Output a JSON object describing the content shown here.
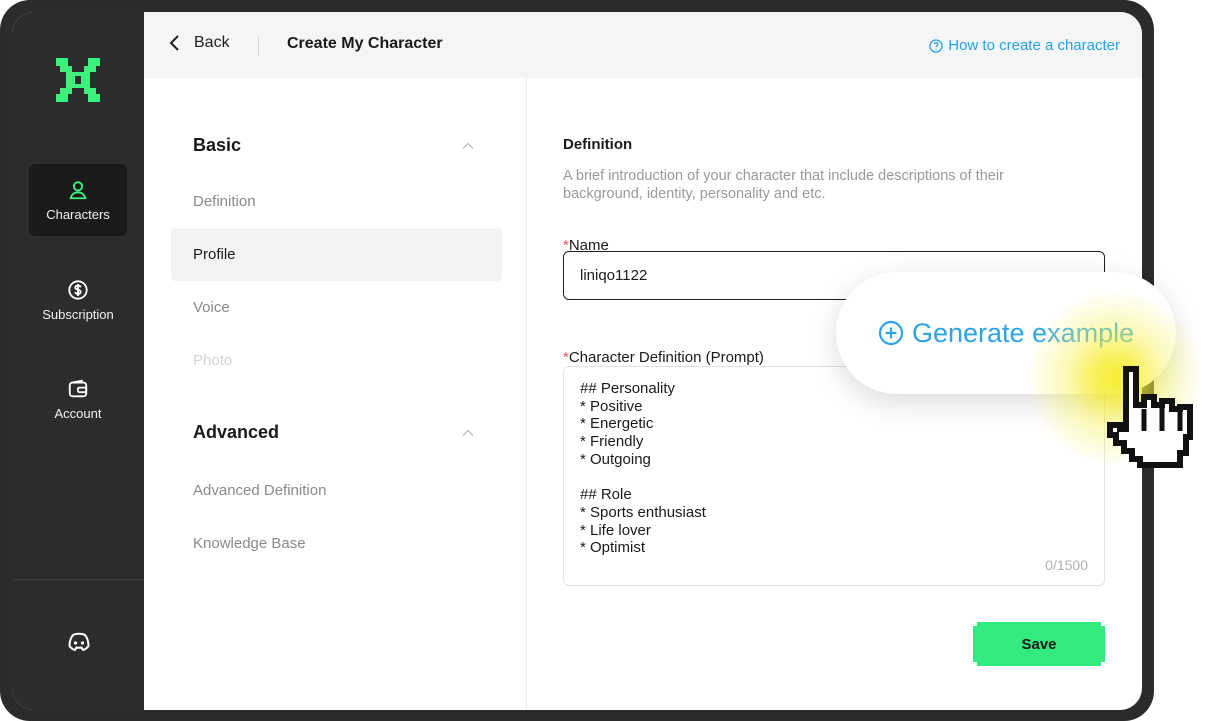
{
  "sidebar": {
    "items": [
      {
        "label": "Characters",
        "icon": "user-icon"
      },
      {
        "label": "Subscription",
        "icon": "dollar-icon"
      },
      {
        "label": "Account",
        "icon": "wallet-icon"
      }
    ],
    "footer_icon": "discord-icon"
  },
  "topbar": {
    "back_label": "Back",
    "title": "Create My Character",
    "help_label": "How to create a character"
  },
  "menu": {
    "basic": {
      "heading": "Basic",
      "items": [
        "Definition",
        "Profile",
        "Voice",
        "Photo"
      ]
    },
    "advanced": {
      "heading": "Advanced",
      "items": [
        "Advanced Definition",
        "Knowledge Base"
      ]
    }
  },
  "form": {
    "section_title": "Definition",
    "section_desc": "A brief introduction of your character that include descriptions of their background, identity, personality and etc.",
    "name_label": "Name",
    "name_value": "liniqo1122",
    "prompt_label": "Character Definition (Prompt)",
    "prompt_lines": [
      "## Personality",
      "* Positive",
      "* Energetic",
      "* Friendly",
      "* Outgoing",
      "",
      "## Role",
      "* Sports enthusiast",
      "* Life lover",
      "* Optimist"
    ],
    "counter": "0/1500",
    "save_label": "Save",
    "required_mark": "*"
  },
  "popup": {
    "label": "Generate example"
  },
  "colors": {
    "accent_green": "#33ea7e",
    "link_blue": "#26a3e6",
    "sidebar_bg": "#2c2c2c"
  }
}
